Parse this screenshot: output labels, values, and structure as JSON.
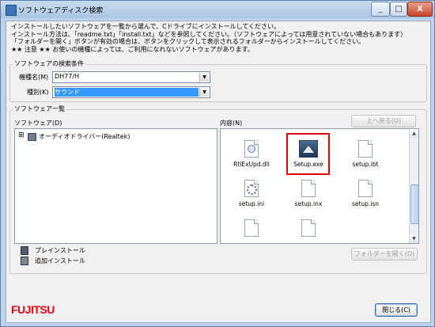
{
  "window": {
    "title": "ソフトウェアディスク検索",
    "controls": [
      "_",
      "□",
      "X"
    ]
  },
  "intro": {
    "line1": "インストールしたいソフトウェアを一覧から選んで、Cドライブにインストールしてください。",
    "line2": "インストール方法は、「readme.txt」「install.txt」などを参照してください。（ソフトウェアによっては用意されていない場合もあります）",
    "line3": "「フォルダーを開く」ボタンが有効の場合は、ボタンをクリックして表示されるフォルダーからインストールしてください。",
    "line4": "★★ 注意 ★★ お使いの機種によっては、ご利用になれないソフトウェアがあります。"
  },
  "search_conditions": {
    "label": "ソフトウェアの検索条件",
    "model_label": "機種名(M)",
    "model_value": "DH77/H",
    "type_label": "種別(K)",
    "type_value": "サウンド"
  },
  "software_list": {
    "group_label": "ソフトウェア一覧",
    "software_header": "ソフトウェア(D)",
    "content_header": "内容(N)",
    "back_button": "上へ戻る(U)",
    "tree": [
      {
        "expander": "⊞",
        "label": "オーディオドライバー(Realtek)"
      }
    ],
    "files": [
      {
        "name": "RtlExUpd.dll",
        "icon": "dll-icon"
      },
      {
        "name": "Setup.exe",
        "icon": "setup-exe-icon",
        "highlighted": true
      },
      {
        "name": "setup.ibt",
        "icon": "file-icon"
      },
      {
        "name": "setup.ini",
        "icon": "ini-settings-icon"
      },
      {
        "name": "setup.inx",
        "icon": "file-icon"
      },
      {
        "name": "setup.isn",
        "icon": "file-icon"
      }
    ],
    "legend": [
      {
        "icon": "preinstall-icon",
        "label": "プレインストール"
      },
      {
        "icon": "add-install-icon",
        "label": "追加インストール"
      }
    ],
    "open_folder_button": "フォルダーを開く(O)"
  },
  "footer": {
    "brand": "FUJITSU",
    "close_button": "閉じる(C)"
  },
  "colors": {
    "highlight_red": "#e00000",
    "selection_blue": "#3399ff",
    "brand_red": "#e60012"
  }
}
